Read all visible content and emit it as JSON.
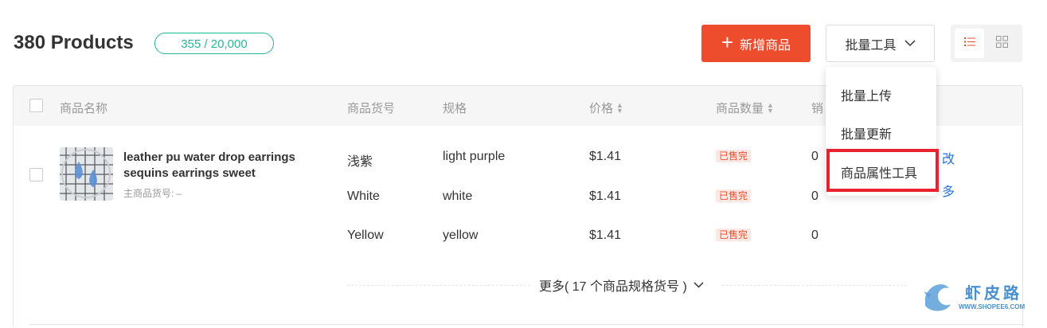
{
  "header": {
    "title": "380 Products",
    "quota": "355 / 20,000",
    "add_button_label": "新增商品",
    "batch_button_label": "批量工具"
  },
  "dropdown": {
    "items": [
      "批量上传",
      "批量更新",
      "商品属性工具"
    ],
    "highlighted_index": 2
  },
  "table": {
    "headers": {
      "name": "商品名称",
      "sku": "商品货号",
      "spec": "规格",
      "price": "价格",
      "stock": "商品数量",
      "sales": "销"
    },
    "product": {
      "name": "leather pu water drop earrings sequins earrings sweet",
      "main_sku": "主商品货号: –",
      "variants": [
        {
          "sku": "浅紫",
          "spec": "light purple",
          "price": "$1.41",
          "status": "已售完",
          "sales": "0"
        },
        {
          "sku": "White",
          "spec": "white",
          "price": "$1.41",
          "status": "已售完",
          "sales": "0"
        },
        {
          "sku": "Yellow",
          "spec": "yellow",
          "price": "$1.41",
          "status": "已售完",
          "sales": "0"
        }
      ],
      "more_label": "更多( 17 个商品规格货号 )",
      "action_edit_partial": "改",
      "action_more_partial": "多"
    }
  },
  "watermark": {
    "text": "虾皮路",
    "url": "WWW.SHOPEE6.COM"
  },
  "colors": {
    "brand": "#ee4d2d",
    "quota": "#26b59a",
    "link": "#2673dd",
    "highlight": "#e8232f"
  }
}
